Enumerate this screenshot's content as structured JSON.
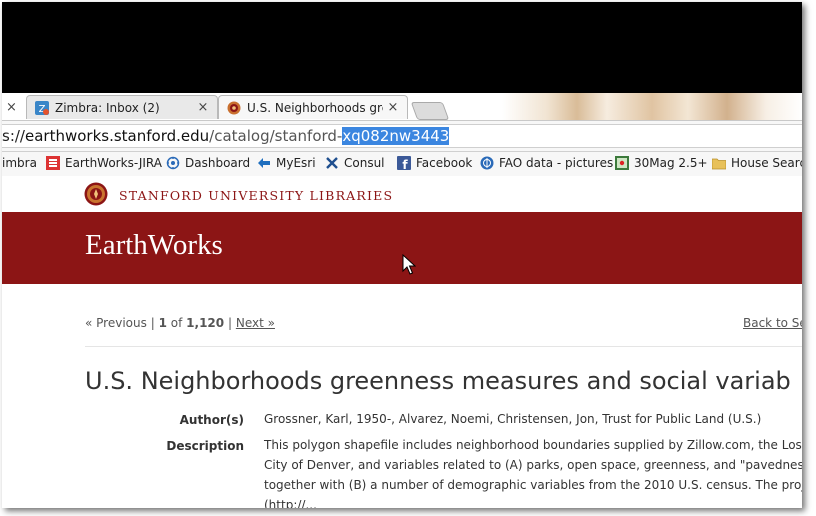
{
  "tabs": [
    {
      "label": "Zimbra: Inbox (2)",
      "close": "×"
    },
    {
      "label": "U.S. Neighborhoods green",
      "close": "×"
    }
  ],
  "left_tab_close": "×",
  "url": {
    "scheme_partial": "s://",
    "host": "earthworks.stanford.edu",
    "path": "/catalog/stanford-",
    "selected": "xq082nw3443"
  },
  "bookmarks": [
    {
      "label": "imbra",
      "icon": "zimbra-icon"
    },
    {
      "label": "EarthWorks-JIRA",
      "icon": "jira-icon"
    },
    {
      "label": "Dashboard",
      "icon": "dashboard-icon"
    },
    {
      "label": "MyEsri",
      "icon": "esri-icon"
    },
    {
      "label": "Consul",
      "icon": "consul-icon"
    },
    {
      "label": "Facebook",
      "icon": "facebook-icon"
    },
    {
      "label": "FAO data - pictures",
      "icon": "fao-icon"
    },
    {
      "label": "30Mag 2.5+",
      "icon": "map-icon"
    },
    {
      "label": "House Search",
      "icon": "folder-icon"
    }
  ],
  "site": {
    "library_name": "STANFORD UNIVERSITY LIBRARIES",
    "brand": "EarthWorks",
    "accent": "#8c1515"
  },
  "pager": {
    "previous": "« Previous",
    "sep1": "|",
    "current": "1",
    "of": "of",
    "total": "1,120",
    "sep2": "|",
    "next": "Next »",
    "back": "Back to Se"
  },
  "record": {
    "title": "U.S. Neighborhoods greenness measures and social variab",
    "author_label": "Author(s)",
    "author_value": "Grossner, Karl, 1950-, Alvarez, Noemi, Christensen, Jon, Trust for Public Land (U.S.)",
    "description_label": "Description",
    "description_lines": [
      "This polygon shapefile includes neighborhood boundaries supplied by Zillow.com, the Los An",
      "City of Denver, and variables related to (A) parks, open space, greenness, and \"pavedness\" (in",
      "together with (B) a number of demographic variables from the 2010 U.S. census. The project,",
      "(http://..."
    ]
  }
}
